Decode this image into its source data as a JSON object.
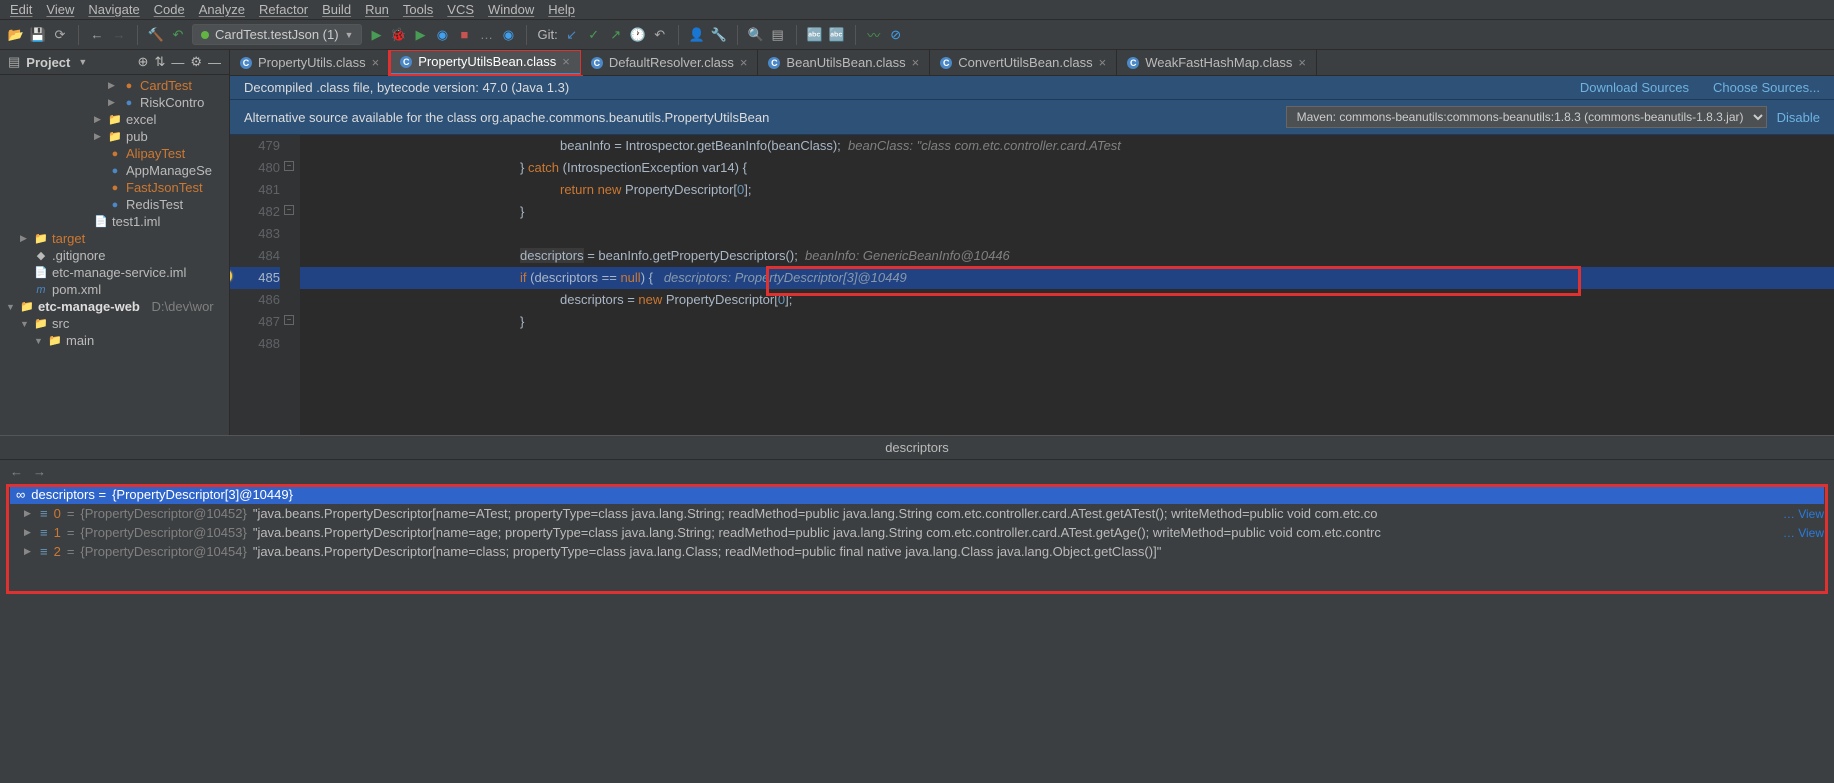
{
  "menu": [
    "Edit",
    "View",
    "Navigate",
    "Code",
    "Analyze",
    "Refactor",
    "Build",
    "Run",
    "Tools",
    "VCS",
    "Window",
    "Help"
  ],
  "run_config": "CardTest.testJson (1)",
  "git_label": "Git:",
  "sidebar_title": "Project",
  "tree": {
    "cardtest": "CardTest",
    "riskcontrol": "RiskContro",
    "excel": "excel",
    "pub": "pub",
    "alipay": "AlipayTest",
    "appmanage": "AppManageSe",
    "fastjson": "FastJsonTest",
    "redis": "RedisTest",
    "test1": "test1.iml",
    "target": "target",
    "gitignore": ".gitignore",
    "etciml": "etc-manage-service.iml",
    "pom": "pom.xml",
    "etcweb": "etc-manage-web",
    "etcweb_path": "D:\\dev\\wor",
    "src": "src",
    "main": "main"
  },
  "tabs": [
    {
      "label": "PropertyUtils.class"
    },
    {
      "label": "PropertyUtilsBean.class",
      "active": true,
      "highlighted": true
    },
    {
      "label": "DefaultResolver.class"
    },
    {
      "label": "BeanUtilsBean.class"
    },
    {
      "label": "ConvertUtilsBean.class"
    },
    {
      "label": "WeakFastHashMap.class"
    }
  ],
  "info1": "Decompiled .class file, bytecode version: 47.0 (Java 1.3)",
  "info_links": {
    "download": "Download Sources",
    "choose": "Choose Sources..."
  },
  "info2": "Alternative source available for the class org.apache.commons.beanutils.PropertyUtilsBean",
  "maven_select": "Maven: commons-beanutils:commons-beanutils:1.8.3 (commons-beanutils-1.8.3.jar)",
  "disable": "Disable",
  "gutter": [
    "479",
    "480",
    "481",
    "482",
    "483",
    "484",
    "485",
    "486",
    "487",
    "488"
  ],
  "code": {
    "l479_a": "beanInfo = Introspector.getBeanInfo(beanClass);  ",
    "l479_b": "beanClass: \"class com.etc.controller.card.ATest",
    "l480_a": "} ",
    "l480_b": "catch",
    "l480_c": " (IntrospectionException var14) {",
    "l481_a": "return new",
    "l481_b": " PropertyDescriptor[",
    "l481_c": "0",
    "l481_d": "];",
    "l482": "}",
    "l484_a": "descriptors",
    "l484_b": " = beanInfo.getPropertyDescriptors();  ",
    "l484_c": "beanInfo: GenericBeanInfo@10446",
    "l485_a": "if",
    "l485_b": " (descriptors == ",
    "l485_c": "null",
    "l485_d": ") {   ",
    "l485_e": "descriptors: PropertyDescriptor[3]@10449",
    "l486_a": "descriptors = ",
    "l486_b": "new",
    "l486_c": " PropertyDescriptor[",
    "l486_d": "0",
    "l486_e": "];",
    "l487": "}"
  },
  "debug_title": "descriptors",
  "debug": {
    "root_a": "descriptors = ",
    "root_b": "{PropertyDescriptor[3]@10449}",
    "rows": [
      {
        "idx": "0",
        "obj": "{PropertyDescriptor@10452}",
        "val": "\"java.beans.PropertyDescriptor[name=ATest; propertyType=class java.lang.String; readMethod=public java.lang.String com.etc.controller.card.ATest.getATest(); writeMethod=public void com.etc.co",
        "view": "… View"
      },
      {
        "idx": "1",
        "obj": "{PropertyDescriptor@10453}",
        "val": "\"java.beans.PropertyDescriptor[name=age; propertyType=class java.lang.String; readMethod=public java.lang.String com.etc.controller.card.ATest.getAge(); writeMethod=public void com.etc.contrc",
        "view": "… View"
      },
      {
        "idx": "2",
        "obj": "{PropertyDescriptor@10454}",
        "val": "\"java.beans.PropertyDescriptor[name=class; propertyType=class java.lang.Class; readMethod=public final native java.lang.Class java.lang.Object.getClass()]\"",
        "view": ""
      }
    ]
  }
}
